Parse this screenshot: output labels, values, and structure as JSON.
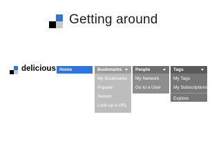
{
  "slide": {
    "title": "Getting around",
    "logo_colors": [
      "#3275d6",
      "#000000",
      "#c8c8c8",
      "#ffffff"
    ]
  },
  "brand": {
    "name": "delicious",
    "logo_colors": [
      "#3275d6",
      "#000000",
      "#c8c8c8",
      "#ffffff"
    ]
  },
  "nav": {
    "home": {
      "label": "Home",
      "color": "#3275d6"
    },
    "bookmarks": {
      "label": "Bookmarks",
      "items": [
        "My Bookmarks",
        "Popular",
        "Recent",
        "Look up a URL"
      ]
    },
    "people": {
      "label": "People",
      "items": [
        "My Network",
        "Go to a User"
      ]
    },
    "tags": {
      "label": "Tags",
      "items": [
        "My Tags",
        "My Subscriptions",
        "Explore"
      ]
    }
  }
}
